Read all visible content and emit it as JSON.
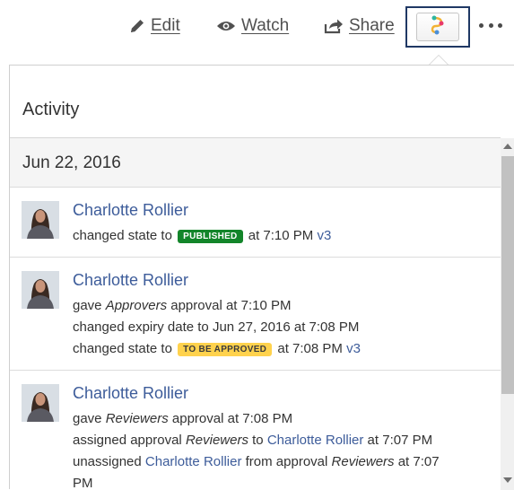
{
  "toolbar": {
    "edit_label": "Edit",
    "watch_label": "Watch",
    "share_label": "Share",
    "workflow_icon": "workflow-icon",
    "more_icon": "more-icon"
  },
  "panel": {
    "title": "Activity",
    "date": "Jun 22, 2016",
    "entries": [
      {
        "user": "Charlotte Rollier",
        "lines": [
          {
            "before": "changed state to",
            "badge": "PUBLISHED",
            "after": "at 7:10 PM",
            "link": "v3"
          }
        ]
      },
      {
        "user": "Charlotte Rollier",
        "lines": [
          {
            "before": "gave",
            "italic": "Approvers",
            "after": "approval at 7:10 PM"
          },
          {
            "text": "changed expiry date to Jun 27, 2016 at 7:08 PM"
          },
          {
            "before": "changed state to",
            "badge": "TO BE APPROVED",
            "after": "at 7:08 PM",
            "link": "v3"
          }
        ]
      },
      {
        "user": "Charlotte Rollier",
        "lines": [
          {
            "before": "gave",
            "italic": "Reviewers",
            "after": "approval at 7:08 PM"
          },
          {
            "before": "assigned approval",
            "italic": "Reviewers",
            "mid": "to",
            "link": "Charlotte Rollier",
            "after": "at 7:07 PM"
          },
          {
            "before": "unassigned",
            "link": "Charlotte Rollier",
            "mid": "from approval",
            "italic": "Reviewers",
            "after": "at 7:07"
          },
          {
            "text": "PM"
          }
        ]
      }
    ]
  },
  "colors": {
    "link": "#3d5c9a",
    "published_badge": "#13852a",
    "to_be_approved_badge": "#ffd24d",
    "workflow_highlight_border": "#1f3864"
  }
}
